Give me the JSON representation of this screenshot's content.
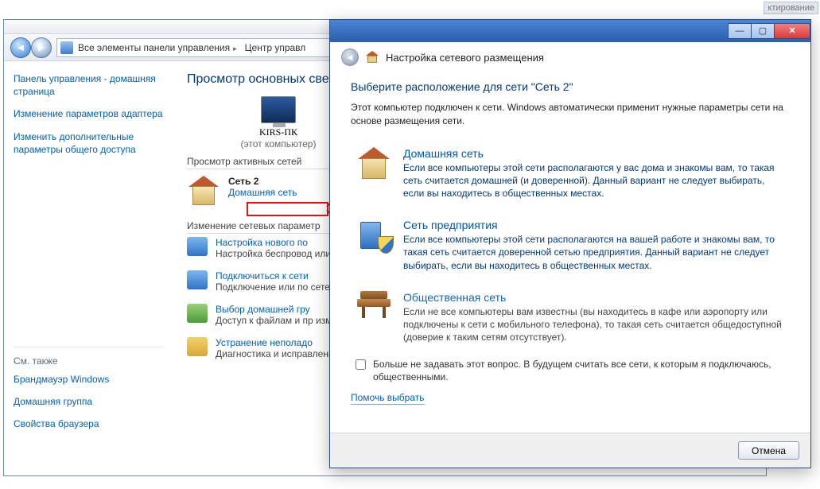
{
  "ghost_label": "ктирование",
  "cp": {
    "addr_root": "Все элементы панели управления",
    "addr_current": "Центр управл",
    "side": {
      "home": "Панель управления - домашняя страница",
      "adapter": "Изменение параметров адаптера",
      "sharing": "Изменить дополнительные параметры общего доступа",
      "see_also": "См. также",
      "firewall": "Брандмауэр Windows",
      "homegroup": "Домашняя группа",
      "browser": "Свойства браузера"
    },
    "main": {
      "title": "Просмотр основных све",
      "pc_name": "KIRS-ПК",
      "pc_sub": "(этот компьютер)",
      "active_label": "Просмотр активных сетей",
      "net_name": "Сеть  2",
      "net_type": "Домашняя сеть",
      "change_label": "Изменение сетевых параметр",
      "links": {
        "new_conn": "Настройка нового по",
        "new_conn_desc": "Настройка беспровод\nили же настройка ма",
        "connect": "Подключиться к сети",
        "connect_desc": "Подключение или по\nсетевому соединени",
        "hg": "Выбор домашней гру",
        "hg_desc": "Доступ к файлам и пр\nизменение параметр",
        "fix": "Устранение неполадо",
        "fix_desc": "Диагностика и исправление сетевых проблем или получение сведений об исправлении."
      }
    }
  },
  "dlg": {
    "header": "Настройка сетевого размещения",
    "title": "Выберите расположение для сети \"Сеть  2\"",
    "intro": "Этот компьютер подключен к сети. Windows автоматически применит нужные параметры сети на основе размещения сети.",
    "options": {
      "home": {
        "title": "Домашняя сеть",
        "desc": "Если все компьютеры этой сети располагаются у вас дома и знакомы вам, то такая сеть считается домашней (и доверенной). Данный вариант не следует выбирать, если вы находитесь в общественных местах."
      },
      "work": {
        "title": "Сеть предприятия",
        "desc": "Если все компьютеры этой сети располагаются на вашей работе и знакомы вам, то такая сеть считается доверенной сетью предприятия. Данный вариант не следует выбирать, если вы находитесь в общественных местах."
      },
      "public": {
        "title": "Общественная сеть",
        "desc": "Если не все компьютеры вам известны (вы находитесь в кафе или аэропорту или подключены к сети с мобильного телефона), то такая сеть считается общедоступной (доверие к таким сетям отсутствует)."
      }
    },
    "checkbox": "Больше не задавать этот вопрос. В будущем считать все сети, к которым я подключаюсь, общественными.",
    "help": "Помочь выбрать",
    "cancel": "Отмена"
  }
}
